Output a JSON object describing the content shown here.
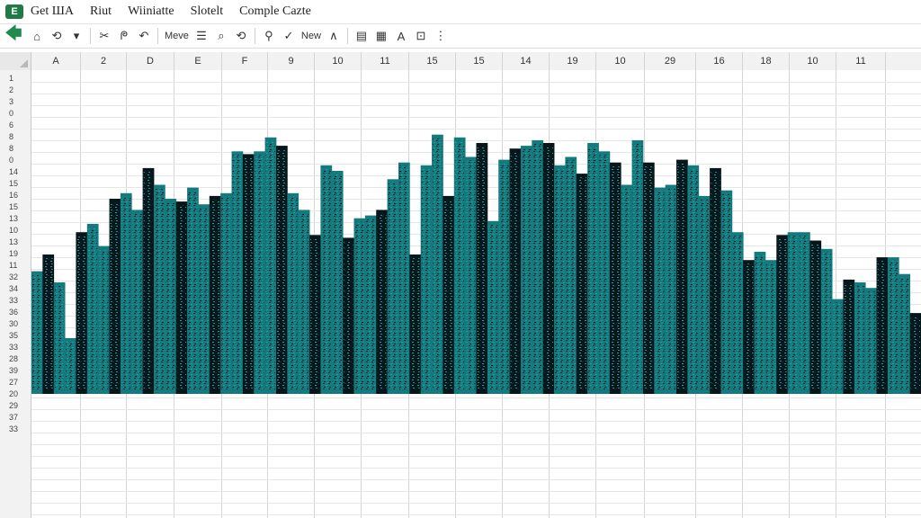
{
  "app": {
    "icon_label": "E"
  },
  "menu": [
    "Get ШA",
    "Riut",
    "Wiiniatte",
    "Slotelt",
    "Comple Cazte"
  ],
  "toolbar": {
    "items": [
      {
        "name": "back-arrow-icon",
        "glyph": "🡄",
        "kind": "back"
      },
      {
        "name": "home-icon",
        "glyph": "⌂"
      },
      {
        "name": "refresh-icon",
        "glyph": "⟲"
      },
      {
        "name": "dropdown-icon",
        "glyph": "▾"
      },
      {
        "name": "sep"
      },
      {
        "name": "cut-icon",
        "glyph": "✂"
      },
      {
        "name": "format-icon",
        "glyph": "ᖘ"
      },
      {
        "name": "undo-icon",
        "glyph": "↶"
      },
      {
        "name": "sep"
      },
      {
        "name": "move-button",
        "text": "Meve",
        "kind": "text"
      },
      {
        "name": "menu-lines-icon",
        "glyph": "☰"
      },
      {
        "name": "search-icon",
        "glyph": "⌕"
      },
      {
        "name": "filter-icon",
        "glyph": "⟲"
      },
      {
        "name": "sep"
      },
      {
        "name": "pin-icon",
        "glyph": "⚲"
      },
      {
        "name": "check-icon",
        "glyph": "✓"
      },
      {
        "name": "new-button",
        "text": "New",
        "kind": "text"
      },
      {
        "name": "caret-up-icon",
        "glyph": "∧"
      },
      {
        "name": "sep"
      },
      {
        "name": "sheet-icon",
        "glyph": "▤"
      },
      {
        "name": "note-icon",
        "glyph": "▦"
      },
      {
        "name": "font-color-icon",
        "glyph": "A"
      },
      {
        "name": "border-dropdown-icon",
        "glyph": "⊡"
      },
      {
        "name": "more-icon",
        "glyph": "⋮"
      }
    ]
  },
  "columns": [
    "A",
    "2",
    "D",
    "E",
    "F",
    "9",
    "10",
    "11",
    "15",
    "15",
    "14",
    "19",
    "10",
    "29",
    "16",
    "18",
    "10",
    "11"
  ],
  "rows": [
    "1",
    "2",
    "3",
    "0",
    "6",
    "8",
    "8",
    "0",
    "14",
    "15",
    "16",
    "15",
    "13",
    "10",
    "13",
    "19",
    "11",
    "32",
    "34",
    "33",
    "36",
    "30",
    "35",
    "33",
    "28",
    "39",
    "27",
    "20",
    "29",
    "37",
    "33"
  ],
  "colors": {
    "bar": "#147a7e",
    "dark": "#06161a",
    "header": "#f2f2f2",
    "grid": "#d4d4d4"
  },
  "chart_data": {
    "type": "bar",
    "title": "",
    "xlabel": "",
    "ylabel": "",
    "ylim": [
      0,
      100
    ],
    "values": [
      44,
      50,
      40,
      20,
      58,
      61,
      53,
      70,
      72,
      66,
      81,
      75,
      70,
      69,
      74,
      68,
      71,
      72,
      87,
      86,
      87,
      92,
      89,
      72,
      66,
      57,
      82,
      80,
      56,
      63,
      64,
      66,
      77,
      83,
      50,
      82,
      93,
      71,
      92,
      85,
      90,
      62,
      84,
      88,
      89,
      91,
      90,
      82,
      85,
      79,
      90,
      87,
      83,
      75,
      91,
      83,
      74,
      75,
      84,
      82,
      71,
      81,
      73,
      58,
      48,
      51,
      48,
      57,
      58,
      58,
      55,
      52,
      34,
      41,
      40,
      38,
      49,
      49,
      43,
      29
    ]
  }
}
